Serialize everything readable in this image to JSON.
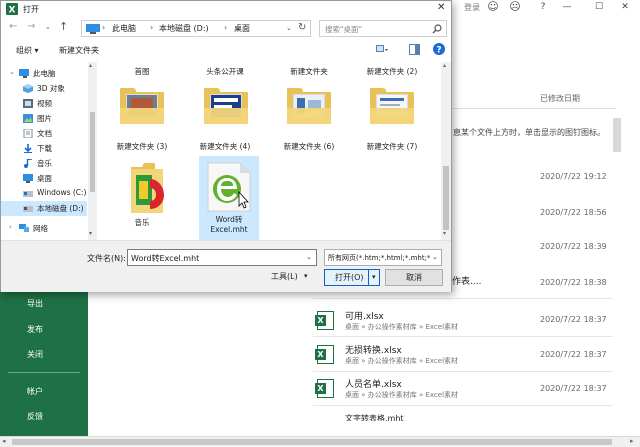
{
  "background": {
    "window_controls": {
      "signin": "登录",
      "minimize": "—",
      "maximize": "☐",
      "close": "✕"
    },
    "sidebar": [
      {
        "label": "导出"
      },
      {
        "label": "发布"
      },
      {
        "label": "关闭"
      },
      {
        "label": "帐户"
      },
      {
        "label": "反馈"
      }
    ],
    "column_header": "已修改日期",
    "hint": "恴某个文件上方时，单击显示的图钉图标。",
    "dates_top": [
      "2020/7/22 19:12",
      "2020/7/22 18:56",
      "2020/7/22 18:39"
    ],
    "partial_name": "作表....",
    "partial_date": "2020/7/22 18:38",
    "recent_files": [
      {
        "name": "可用.xlsx",
        "path": "桌面 » 办公操作素材库 » Excel素材",
        "date": "2020/7/22 18:37"
      },
      {
        "name": "无损转换.xlsx",
        "path": "桌面 » 办公操作素材库 » Excel素材",
        "date": "2020/7/22 18:37"
      },
      {
        "name": "人员名单.xlsx",
        "path": "桌面 » 办公操作素材库 » Excel素材",
        "date": "2020/7/22 18:37"
      }
    ],
    "cut_off_row": "文字转表格.mht"
  },
  "dialog": {
    "title": "打开",
    "close_label": "✕",
    "breadcrumb": [
      "此电脑",
      "本地磁盘 (D:)",
      "桌面"
    ],
    "breadcrumb_sep": "›",
    "search_placeholder": "搜索\"桌面\"",
    "toolbar": {
      "organize": "组织 ▾",
      "new_folder": "新建文件夹"
    },
    "nav": [
      {
        "label": "此电脑",
        "icon": "computer-icon"
      },
      {
        "label": "3D 对象",
        "icon": "cube-icon"
      },
      {
        "label": "视频",
        "icon": "video-icon"
      },
      {
        "label": "图片",
        "icon": "picture-icon"
      },
      {
        "label": "文档",
        "icon": "document-icon"
      },
      {
        "label": "下载",
        "icon": "download-icon"
      },
      {
        "label": "音乐",
        "icon": "music-icon"
      },
      {
        "label": "桌面",
        "icon": "desktop-icon"
      },
      {
        "label": "Windows (C:)",
        "icon": "drive-icon"
      },
      {
        "label": "本地磁盘 (D:)",
        "icon": "drive-icon",
        "selected": true
      },
      {
        "label": "网络",
        "icon": "network-icon"
      }
    ],
    "top_row_labels": [
      "首图",
      "头条公开课",
      "新建文件夹",
      "新建文件夹 (2)"
    ],
    "folders": [
      {
        "label": "新建文件夹 (3)"
      },
      {
        "label": "新建文件夹 (4)"
      },
      {
        "label": "新建文件夹 (6)"
      },
      {
        "label": "新建文件夹 (7)"
      }
    ],
    "music_label": "音乐",
    "mht_file": {
      "line1": "Word转",
      "line2": "Excel.mht"
    },
    "filename_label": "文件名(N):",
    "filename_value": "Word转Excel.mht",
    "filetype_value": "所有网页(*.htm;*.html;*.mht;*.",
    "tools_label": "工具(L)",
    "open_label": "打开(O)",
    "cancel_label": "取消"
  },
  "colors": {
    "excel_green": "#1e7145",
    "accent_blue": "#0a64c8",
    "selection": "#cce8ff"
  }
}
